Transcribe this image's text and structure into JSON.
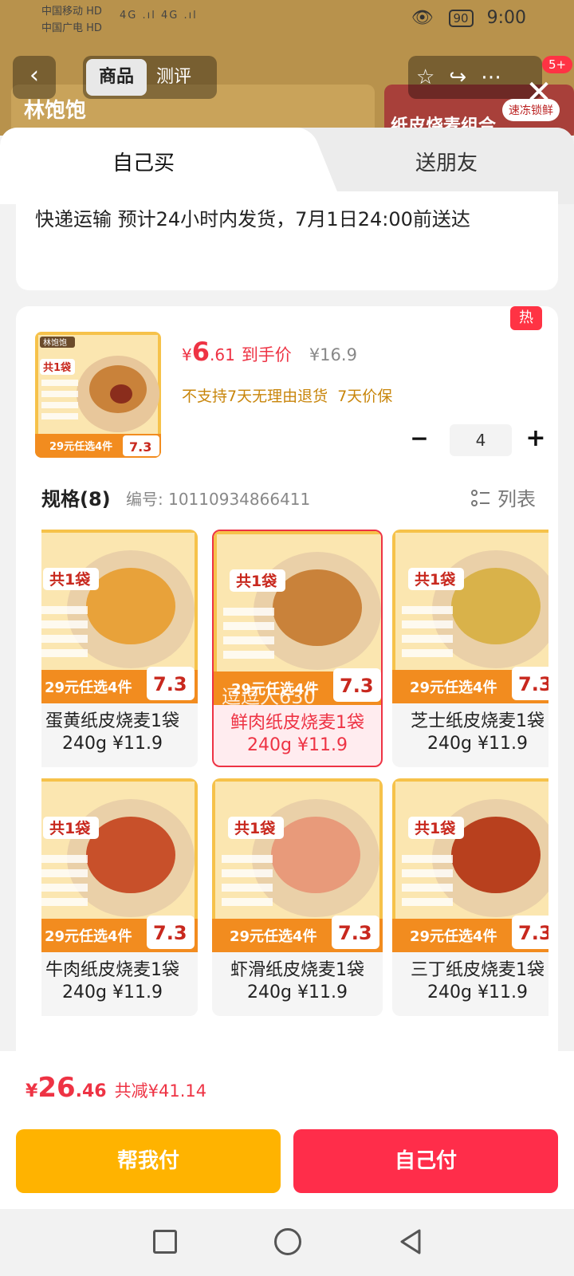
{
  "status_bar": {
    "carrier_1": "中国移动",
    "carrier_2": "中国广电",
    "hd": "HD",
    "signal": "4G .ıl 4G .ıl",
    "battery": "90",
    "time": "9:00"
  },
  "background": {
    "logo": "林饱饱",
    "banner_text": "纸皮烧麦组合",
    "banner_badge": "速冻锁鲜"
  },
  "top_nav": {
    "back_icon": "chevron-left-icon",
    "tabs": [
      "商品",
      "测评"
    ],
    "active_tab": "商品",
    "cart_badge": "5+"
  },
  "sheet": {
    "tabs": [
      "自己买",
      "送朋友"
    ],
    "shipping": "快递运输 预计24小时内发货，7月1日24:00前送达",
    "product": {
      "price_symbol": "¥",
      "price_int": "6",
      "price_dec": ".61",
      "price_label": "到手价",
      "original_price": "¥16.9",
      "policy_1": "不支持7天无理由退货",
      "policy_2": "7天价保",
      "quantity": "4",
      "minus": "−",
      "plus": "+"
    },
    "spec": {
      "title": "规格(8)",
      "code": "编号: 10110934866411",
      "list_label": "列表"
    },
    "hot": "热",
    "watermark": "逗逗人630",
    "skus": [
      {
        "name": "蛋黄纸皮烧麦1袋",
        "price": "240g ¥11.9",
        "selected": false
      },
      {
        "name": "鲜肉纸皮烧麦1袋",
        "price": "240g ¥11.9",
        "selected": true
      },
      {
        "name": "芝士纸皮烧麦1袋",
        "price": "240g ¥11.9",
        "selected": false
      },
      {
        "name": "牛肉纸皮烧麦1袋",
        "price": "240g ¥11.9",
        "selected": false
      },
      {
        "name": "虾滑纸皮烧麦1袋",
        "price": "240g ¥11.9",
        "selected": false
      },
      {
        "name": "三丁纸皮烧麦1袋",
        "price": "240g ¥11.9",
        "selected": false
      }
    ],
    "sku_image_text": {
      "bag": "共1袋",
      "promo": "29元任选4件",
      "promo_price": "7.3"
    }
  },
  "footer": {
    "total_symbol": "¥",
    "total_int": "26",
    "total_dec": ".46",
    "total_save": "共减¥41.14",
    "btn_help": "帮我付",
    "btn_self": "自己付"
  },
  "colors": {
    "accent_red": "#ee3344",
    "help_yellow": "#ffb300",
    "pay_red": "#ff2d4a"
  }
}
